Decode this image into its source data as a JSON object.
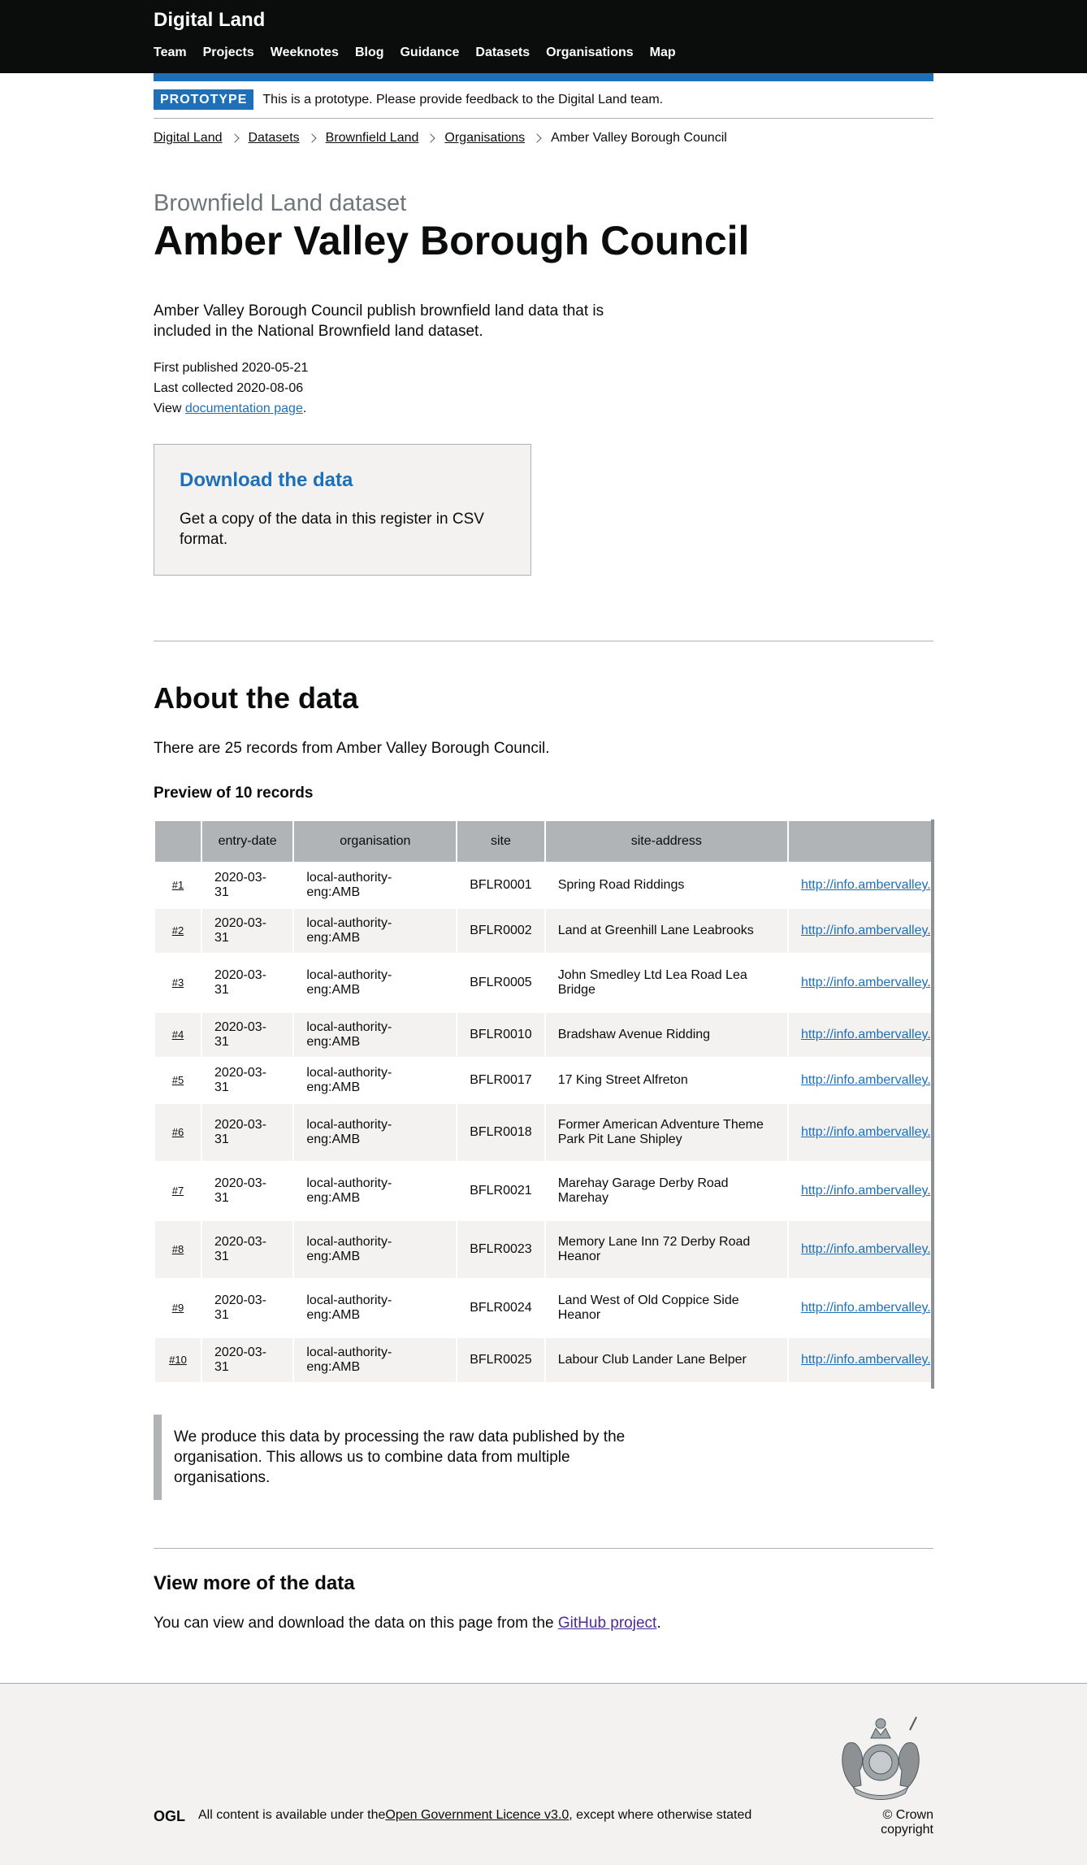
{
  "header": {
    "logo": "Digital Land",
    "nav": [
      "Team",
      "Projects",
      "Weeknotes",
      "Blog",
      "Guidance",
      "Datasets",
      "Organisations",
      "Map"
    ]
  },
  "phase_banner": {
    "tag": "PROTOTYPE",
    "text": "This is a prototype. Please provide feedback to the Digital Land team."
  },
  "breadcrumbs": {
    "items": [
      "Digital Land",
      "Datasets",
      "Brownfield Land",
      "Organisations"
    ],
    "current": "Amber Valley Borough Council"
  },
  "page": {
    "caption": "Brownfield Land dataset",
    "title": "Amber Valley Borough Council",
    "lede": "Amber Valley Borough Council publish brownfield land data that is included in the National Brownfield land dataset.",
    "first_published": "First published 2020-05-21",
    "last_collected": "Last collected 2020-08-06",
    "view_prefix": "View ",
    "doc_link": "documentation page",
    "view_suffix": "."
  },
  "download": {
    "heading": "Download the data",
    "text": "Get a copy of the data in this register in CSV format."
  },
  "about": {
    "heading": "About the data",
    "count_text": "There are 25 records from Amber Valley Borough Council.",
    "preview_heading": "Preview of 10 records",
    "columns": [
      "",
      "entry-date",
      "organisation",
      "site",
      "site-address",
      ""
    ],
    "rows": [
      {
        "num": "#1",
        "date": "2020-03-31",
        "org": "local-authority-eng:AMB",
        "site": "BFLR0001",
        "address": "Spring Road Riddings",
        "link": "http://info.ambervalley.gov.uk"
      },
      {
        "num": "#2",
        "date": "2020-03-31",
        "org": "local-authority-eng:AMB",
        "site": "BFLR0002",
        "address": "Land at Greenhill Lane Leabrooks",
        "link": "http://info.ambervalley.gov.uk"
      },
      {
        "num": "#3",
        "date": "2020-03-31",
        "org": "local-authority-eng:AMB",
        "site": "BFLR0005",
        "address": "John Smedley Ltd Lea Road Lea Bridge",
        "link": "http://info.ambervalley.gov.uk"
      },
      {
        "num": "#4",
        "date": "2020-03-31",
        "org": "local-authority-eng:AMB",
        "site": "BFLR0010",
        "address": "Bradshaw Avenue Ridding",
        "link": "http://info.ambervalley.gov.uk"
      },
      {
        "num": "#5",
        "date": "2020-03-31",
        "org": "local-authority-eng:AMB",
        "site": "BFLR0017",
        "address": "17 King Street Alfreton",
        "link": "http://info.ambervalley.gov.uk"
      },
      {
        "num": "#6",
        "date": "2020-03-31",
        "org": "local-authority-eng:AMB",
        "site": "BFLR0018",
        "address": "Former American Adventure Theme Park Pit Lane Shipley",
        "link": "http://info.ambervalley.gov.uk"
      },
      {
        "num": "#7",
        "date": "2020-03-31",
        "org": "local-authority-eng:AMB",
        "site": "BFLR0021",
        "address": "Marehay Garage Derby Road Marehay",
        "link": "http://info.ambervalley.gov.uk"
      },
      {
        "num": "#8",
        "date": "2020-03-31",
        "org": "local-authority-eng:AMB",
        "site": "BFLR0023",
        "address": "Memory Lane Inn 72 Derby Road Heanor",
        "link": "http://info.ambervalley.gov.uk"
      },
      {
        "num": "#9",
        "date": "2020-03-31",
        "org": "local-authority-eng:AMB",
        "site": "BFLR0024",
        "address": "Land West of Old Coppice Side Heanor",
        "link": "http://info.ambervalley.gov.uk"
      },
      {
        "num": "#10",
        "date": "2020-03-31",
        "org": "local-authority-eng:AMB",
        "site": "BFLR0025",
        "address": "Labour Club Lander Lane Belper",
        "link": "http://info.ambervalley.gov.uk"
      }
    ],
    "inset": "We produce this data by processing the raw data published by the organisation. This allows us to combine data from multiple organisations."
  },
  "more": {
    "heading": "View more of the data",
    "prefix": "You can view and download the data on this page from the ",
    "link": "GitHub project",
    "suffix": "."
  },
  "footer": {
    "licence_prefix": "All content is available under the ",
    "licence_link": "Open Government Licence v3.0",
    "licence_suffix": ", except where otherwise stated",
    "copyright": "© Crown copyright",
    "ogl_logo": "OGL"
  },
  "colors": {
    "header_bg": "#0b0c0c",
    "accent_blue": "#1d70b8",
    "table_header": "#b1b4b6",
    "stripe": "#f3f2f1",
    "visited_link": "#4c2c92"
  }
}
